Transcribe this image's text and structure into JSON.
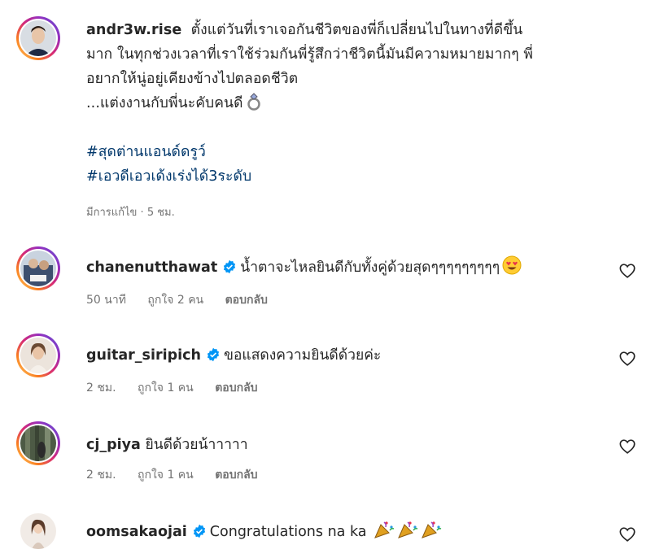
{
  "post": {
    "username": "andr3w.rise",
    "caption_lines": [
      "ตั้งแต่วันที่เราเจอกันชีวิตของพี่ก็เปลี่ยนไปในทางที่ดีขึ้น",
      "มาก ในทุกช่วงเวลาที่เราใช้ร่วมกันพี่รู้สึกว่าชีวิตนี้มันมีความหมายมากๆ พี่",
      "อยากให้นู่อยู่เคียงข้างไปตลอดชีวิต",
      "...แต่งงานกับพี่นะคับคนดี"
    ],
    "ring_icon": "ring-icon",
    "hashtags": [
      "#สุดต่านแอนด์ดรูว์",
      "#เอวดีเอวเด้งเร่งได้3ระดับ"
    ],
    "edited_label": "มีการแก้ไข",
    "time": "5 ชม.",
    "separator": "·"
  },
  "comments": [
    {
      "username": "chanenutthawat",
      "verified": true,
      "text": "น้ำตาจะไหลยินดีกับทั้งคู่ด้วยสุดๆๆๆๆๆๆๆๆๆ",
      "emoji": "heart-eyes-emoji",
      "time": "50 นาที",
      "likes": "ถูกใจ 2 คน",
      "reply": "ตอบกลับ"
    },
    {
      "username": "guitar_siripich",
      "verified": true,
      "text": "ขอแสดงความยินดีด้วยค่ะ",
      "time": "2 ชม.",
      "likes": "ถูกใจ 1 คน",
      "reply": "ตอบกลับ"
    },
    {
      "username": "cj_piya",
      "verified": false,
      "text": "ยินดีด้วยน้าาาาา",
      "time": "2 ชม.",
      "likes": "ถูกใจ 1 คน",
      "reply": "ตอบกลับ"
    },
    {
      "username": "oomsakaojai",
      "verified": true,
      "text": "Congratulations na ka",
      "emoji": "party-popper-emoji"
    }
  ],
  "colors": {
    "verified": "#0095f6",
    "hashtag": "#00376b",
    "meta": "#737373"
  }
}
